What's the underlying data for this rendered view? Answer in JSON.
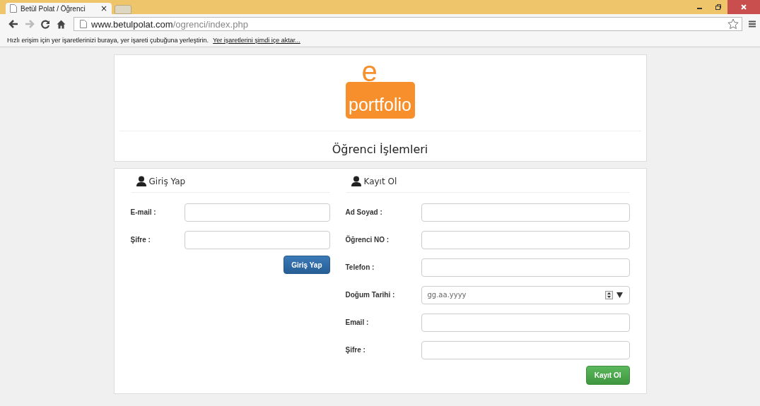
{
  "browser": {
    "tab_title": "Betül Polat / Öğrenci",
    "tab_close": "×",
    "url_host": "www.betulpolat.com",
    "url_path": "/ogrenci/index.php",
    "bookmark_hint": "Hızlı erişim için yer işaretlerinizi buraya, yer işareti çubuğuna yerleştirin.",
    "bookmark_link": "Yer işaretlerini şimdi içe aktar..."
  },
  "logo": {
    "letter": "e",
    "word": "portfolio"
  },
  "page_title": "Öğrenci İşlemleri",
  "login": {
    "heading": "Giriş Yap",
    "fields": [
      {
        "label": "E-mail :",
        "kind": "text"
      },
      {
        "label": "Şifre :",
        "kind": "text"
      }
    ],
    "button": "Giriş Yap"
  },
  "register": {
    "heading": "Kayıt Ol",
    "fields": [
      {
        "label": "Ad Soyad :",
        "kind": "text"
      },
      {
        "label": "Öğrenci NO :",
        "kind": "text"
      },
      {
        "label": "Telefon :",
        "kind": "text"
      },
      {
        "label": "Doğum Tarihi :",
        "kind": "date",
        "placeholder": "gg.aa.yyyy"
      },
      {
        "label": "Email :",
        "kind": "text"
      },
      {
        "label": "Şifre :",
        "kind": "text"
      }
    ],
    "button": "Kayıt Ol"
  }
}
